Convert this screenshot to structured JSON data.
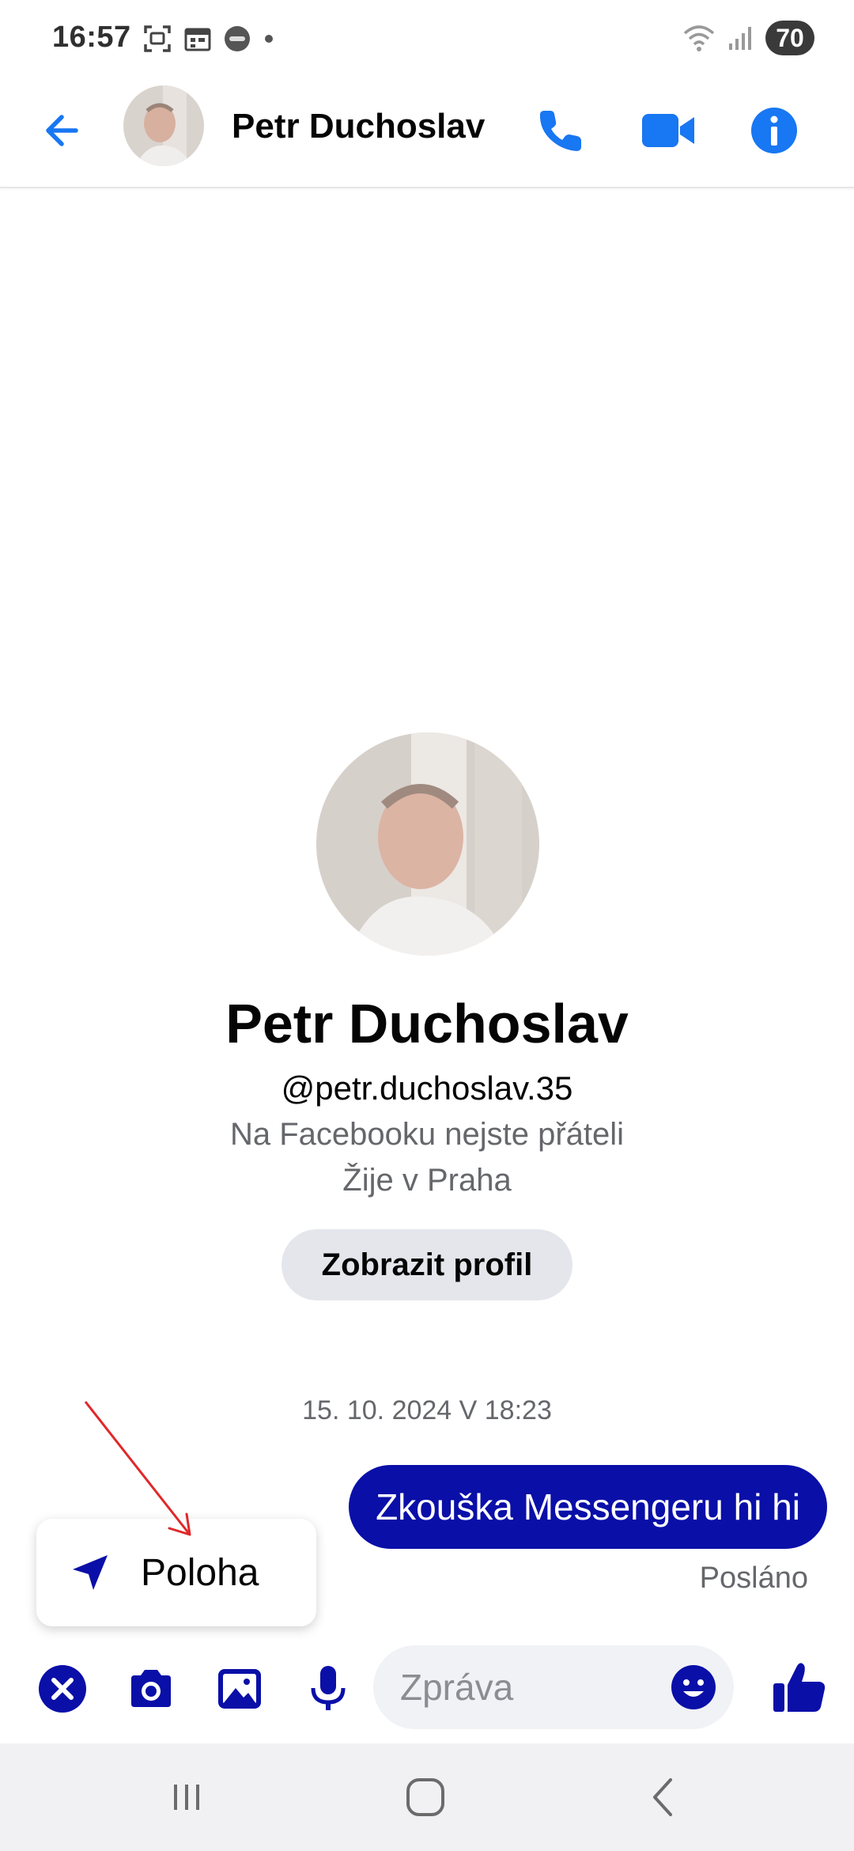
{
  "status_bar": {
    "time": "16:57",
    "battery": "70",
    "left_icons": [
      "screenshot-icon",
      "calendar-icon",
      "wear-icon",
      "dot-icon"
    ],
    "right_icons": [
      "wifi-icon",
      "signal-icon"
    ]
  },
  "header": {
    "contact_name": "Petr Duchoslav",
    "icons": [
      "back-arrow-icon",
      "phone-icon",
      "video-icon",
      "info-icon"
    ]
  },
  "profile": {
    "name": "Petr Duchoslav",
    "handle": "@petr.duchoslav.35",
    "friend_status": "Na Facebooku nejste přáteli",
    "location": "Žije v Praha",
    "view_profile_label": "Zobrazit profil"
  },
  "conversation": {
    "timestamp": "15. 10. 2024 V 18:23",
    "messages": [
      {
        "text": "Zkouška Messengeru hi hi",
        "from": "me"
      }
    ],
    "sent_status": "Posláno"
  },
  "popup_menu": {
    "items": [
      {
        "label": "Poloha",
        "icon": "location-arrow-icon"
      }
    ]
  },
  "composer": {
    "placeholder": "Zpráva",
    "value": "",
    "icons": [
      "close-icon",
      "camera-icon",
      "gallery-icon",
      "microphone-icon",
      "emoji-icon",
      "like-icon"
    ]
  },
  "colors": {
    "accent": "#1877f2",
    "composer_accent": "#0a0fa8",
    "bubble": "#0a0fa8",
    "annotation_arrow": "#e0282a"
  }
}
